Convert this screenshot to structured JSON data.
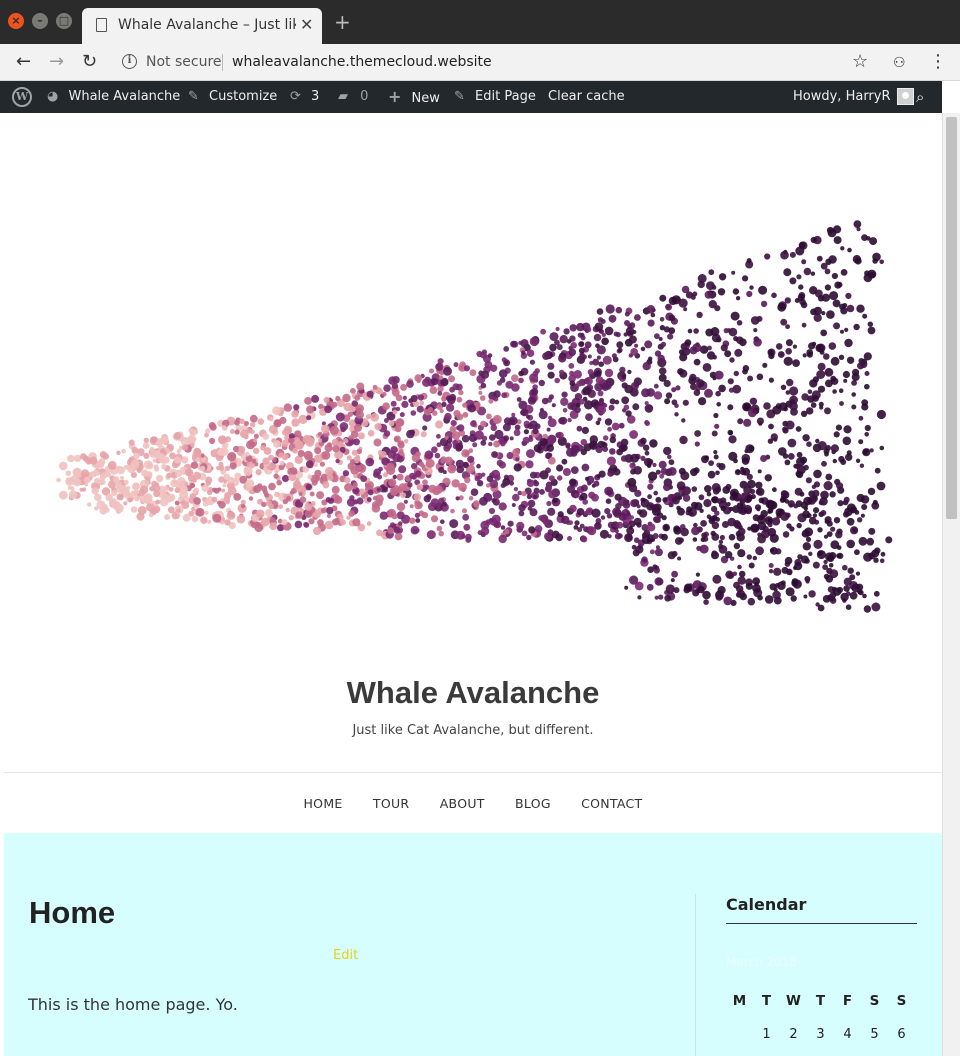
{
  "browser": {
    "tab_title": "Whale Avalanche – Just like Cat Avalanche, but different.",
    "new_tab": "+",
    "security_label": "Not secure",
    "url": "whaleavalanche.themecloud.website"
  },
  "admin_bar": {
    "site_name": "Whale Avalanche",
    "customize": "Customize",
    "updates_count": "3",
    "comments_count": "0",
    "new": "New",
    "edit_page": "Edit Page",
    "clear_cache": "Clear cache",
    "howdy": "Howdy, HarryR"
  },
  "site": {
    "title": "Whale Avalanche",
    "tagline": "Just like Cat Avalanche, but different."
  },
  "nav": {
    "items": [
      "HOME",
      "TOUR",
      "ABOUT",
      "BLOG",
      "CONTACT"
    ]
  },
  "page": {
    "heading": "Home",
    "edit_link": "Edit",
    "body": "This is the home page. Yo."
  },
  "sidebar": {
    "widget_title": "Calendar",
    "calendar": {
      "caption": "March 2018",
      "weekdays": [
        "M",
        "T",
        "W",
        "T",
        "F",
        "S",
        "S"
      ],
      "first_row": [
        "",
        "1",
        "2",
        "3",
        "4",
        "5",
        "6"
      ]
    }
  },
  "colors": {
    "content_bg": "#d7fefe",
    "admin_bar": "#23282d",
    "edit_link": "#e6d21a",
    "art_dark": "#3d1240",
    "art_mid": "#7a2a72",
    "art_light": "#f0c2c0"
  }
}
